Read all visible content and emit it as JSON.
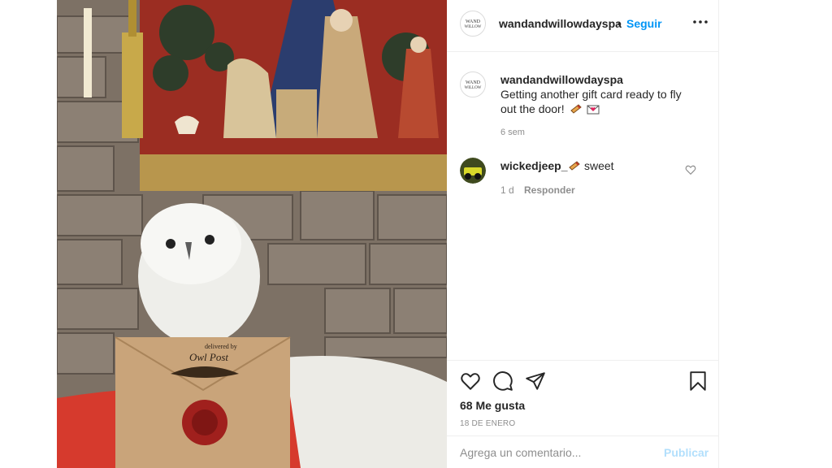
{
  "post": {
    "username": "wandandwillowdayspa",
    "dot": "•",
    "follow_label": "Seguir",
    "more_icon": "more-dots-icon",
    "avatar_logo_text": "WAND & WILLOW"
  },
  "photo": {
    "envelope_line1": "delivered by",
    "envelope_line2": "Owl Post"
  },
  "caption": {
    "username": "wandandwillowdayspa",
    "text": "Getting another gift card ready to fly out the door!",
    "emojis": [
      "scroll-emoji",
      "envelope-heart-emoji"
    ],
    "time": "6 sem"
  },
  "comment": {
    "username": "wickedjeep_",
    "emoji": "scroll-emoji",
    "text": "sweet",
    "time": "1 d",
    "reply_label": "Responder",
    "like_icon": "heart-outline-icon"
  },
  "actions": {
    "icons": [
      "heart-icon",
      "comment-bubble-icon",
      "paper-plane-icon",
      "bookmark-icon"
    ],
    "likes": "68 Me gusta",
    "date": "18 DE ENERO"
  },
  "comment_box": {
    "placeholder": "Agrega un comentario...",
    "publish_label": "Publicar"
  },
  "colors": {
    "accent": "#0095f6",
    "publish_disabled": "#b2dffc",
    "secondary_text": "#8e8e8e",
    "primary_text": "#262626"
  }
}
